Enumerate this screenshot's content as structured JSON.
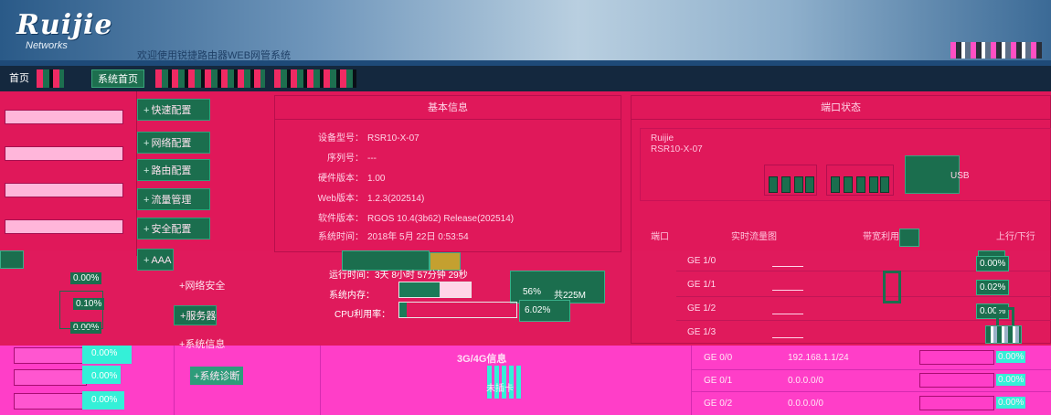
{
  "header": {
    "logo": "Ruijie",
    "logo_sub": "Networks",
    "welcome": "欢迎使用锐捷路由器WEB网管系统"
  },
  "nav": {
    "home": "首页",
    "active_tab": "系统首页"
  },
  "side_menu": [
    {
      "label": "快速配置"
    },
    {
      "label": "网络配置"
    },
    {
      "label": "路由配置"
    },
    {
      "label": "流量管理"
    },
    {
      "label": "安全配置"
    },
    {
      "label": "AAA"
    }
  ],
  "side_menu2": [
    {
      "label": "网络安全"
    },
    {
      "label": "服务器"
    },
    {
      "label": "系统信息"
    },
    {
      "label": "系统诊断"
    }
  ],
  "basic_info": {
    "title": "基本信息",
    "rows": [
      {
        "key": "设备型号：",
        "value": "RSR10-X-07"
      },
      {
        "key": "序列号：",
        "value": "---"
      },
      {
        "key": "硬件版本：",
        "value": "1.00"
      },
      {
        "key": "Web版本：",
        "value": "1.2.3(202514)"
      },
      {
        "key": "软件版本：",
        "value": "RGOS 10.4(3b62) Release(202514)"
      },
      {
        "key": "系统时间：",
        "value": "2018年 5月 22日 0:53:54"
      }
    ],
    "uptime_label": "运行时间：",
    "uptime_value": "3天 8小时 57分钟 29秒",
    "memory_label": "系统内存：",
    "memory_value": "56%",
    "memory_total": "共225M",
    "memory_pct": 0.56,
    "cpu_label": "CPU利用率：",
    "cpu_value": "6.02%",
    "cpu_pct": 0.0602
  },
  "port_panel": {
    "title": "端口状态",
    "model_line1": "Ruijie",
    "model_line2": "RSR10-X-07",
    "usb_label": "USB",
    "col_headers": [
      "端口",
      "实时流量图",
      "带宽利用率",
      "上行/下行"
    ],
    "rows": [
      {
        "name": "GE 1/0",
        "pct": "0.00%"
      },
      {
        "name": "GE 1/1",
        "pct": "0.02%"
      },
      {
        "name": "GE 1/2",
        "pct": "0.00%"
      },
      {
        "name": "GE 1/3",
        "pct": ""
      }
    ]
  },
  "left_pcts": [
    "0.00%",
    "0.10%",
    "0.00%"
  ],
  "bottom": {
    "pink_pcts": [
      "0.00%",
      "0.00%",
      "0.00%"
    ],
    "diag_label": "系统诊断",
    "g4_title": "3G/4G信息",
    "g4_caption": "未插卡",
    "rows": [
      {
        "iface": "GE 0/0",
        "ip": "192.168.1.1/24",
        "pct": "0.00%"
      },
      {
        "iface": "GE 0/1",
        "ip": "0.0.0.0/0",
        "pct": "0.00%"
      },
      {
        "iface": "GE 0/2",
        "ip": "0.0.0.0/0",
        "pct": "0.00%"
      }
    ]
  }
}
